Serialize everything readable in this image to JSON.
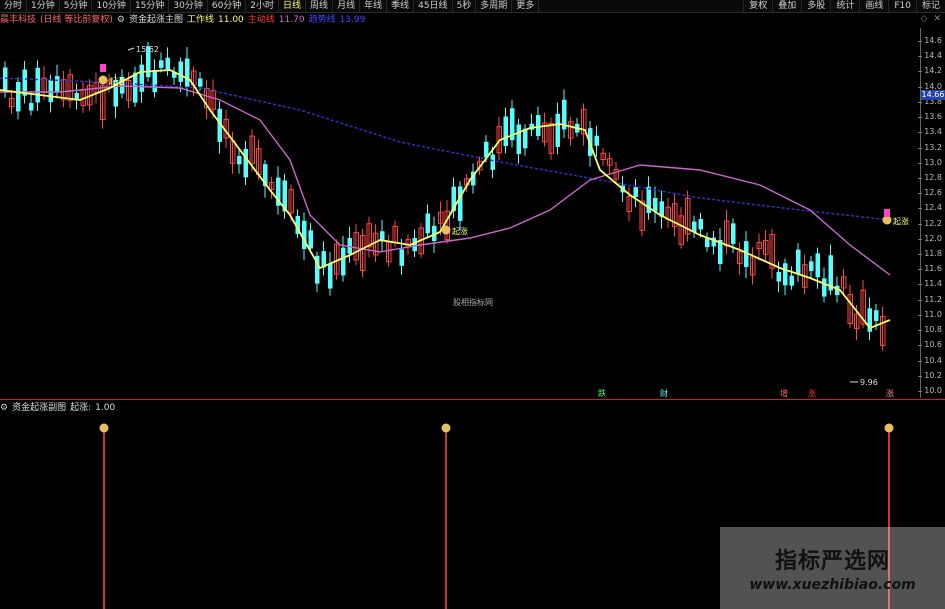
{
  "toolbar": {
    "periods": [
      "分时",
      "1分钟",
      "5分钟",
      "10分钟",
      "15分钟",
      "30分钟",
      "60分钟",
      "2小时",
      "日线",
      "周线",
      "月线",
      "年线",
      "季线",
      "45日线",
      "5秒",
      "多周期",
      "更多"
    ],
    "active_period": "日线",
    "right_buttons": [
      "复权",
      "叠加",
      "多股",
      "统计",
      "画线",
      "F10",
      "标记"
    ]
  },
  "main_info": {
    "stock_name": "晨丰科技",
    "mode": "(日线 等比前复权)",
    "indicator": "资金起涨主图",
    "work_line_label": "工作线",
    "work_line_value": "11.00",
    "main_line_label": "主动线",
    "main_line_value": "11.70",
    "trend_line_label": "趋势线",
    "trend_line_value": "13.99"
  },
  "sub_info": {
    "indicator": "资金起涨副图",
    "signal_label": "起涨:",
    "signal_value": "1.00"
  },
  "price_axis": {
    "ticks": [
      "14.6",
      "14.4",
      "14.2",
      "14.0",
      "13.8",
      "13.6",
      "13.4",
      "13.2",
      "13.0",
      "12.8",
      "12.6",
      "12.4",
      "12.2",
      "12.0",
      "11.8",
      "11.6",
      "11.4",
      "11.2",
      "11.0",
      "10.8",
      "10.6",
      "10.4",
      "10.2",
      "10.0"
    ],
    "current_price": "14.66"
  },
  "annotations": {
    "high": "15.62",
    "low": "9.96",
    "qizhang": "起涨",
    "center_watermark": "股相指标网",
    "bottom_labels": [
      "跌",
      "财",
      "增",
      "涨",
      "涨"
    ]
  },
  "colors": {
    "up": "#ff4444",
    "down": "#55ffff",
    "work_line": "#ffff66",
    "main_line": "#cc66cc",
    "trend_line": "#3333cc"
  },
  "watermark": {
    "title": "指标严选网",
    "url": "www.xuezhibiao.com"
  }
}
